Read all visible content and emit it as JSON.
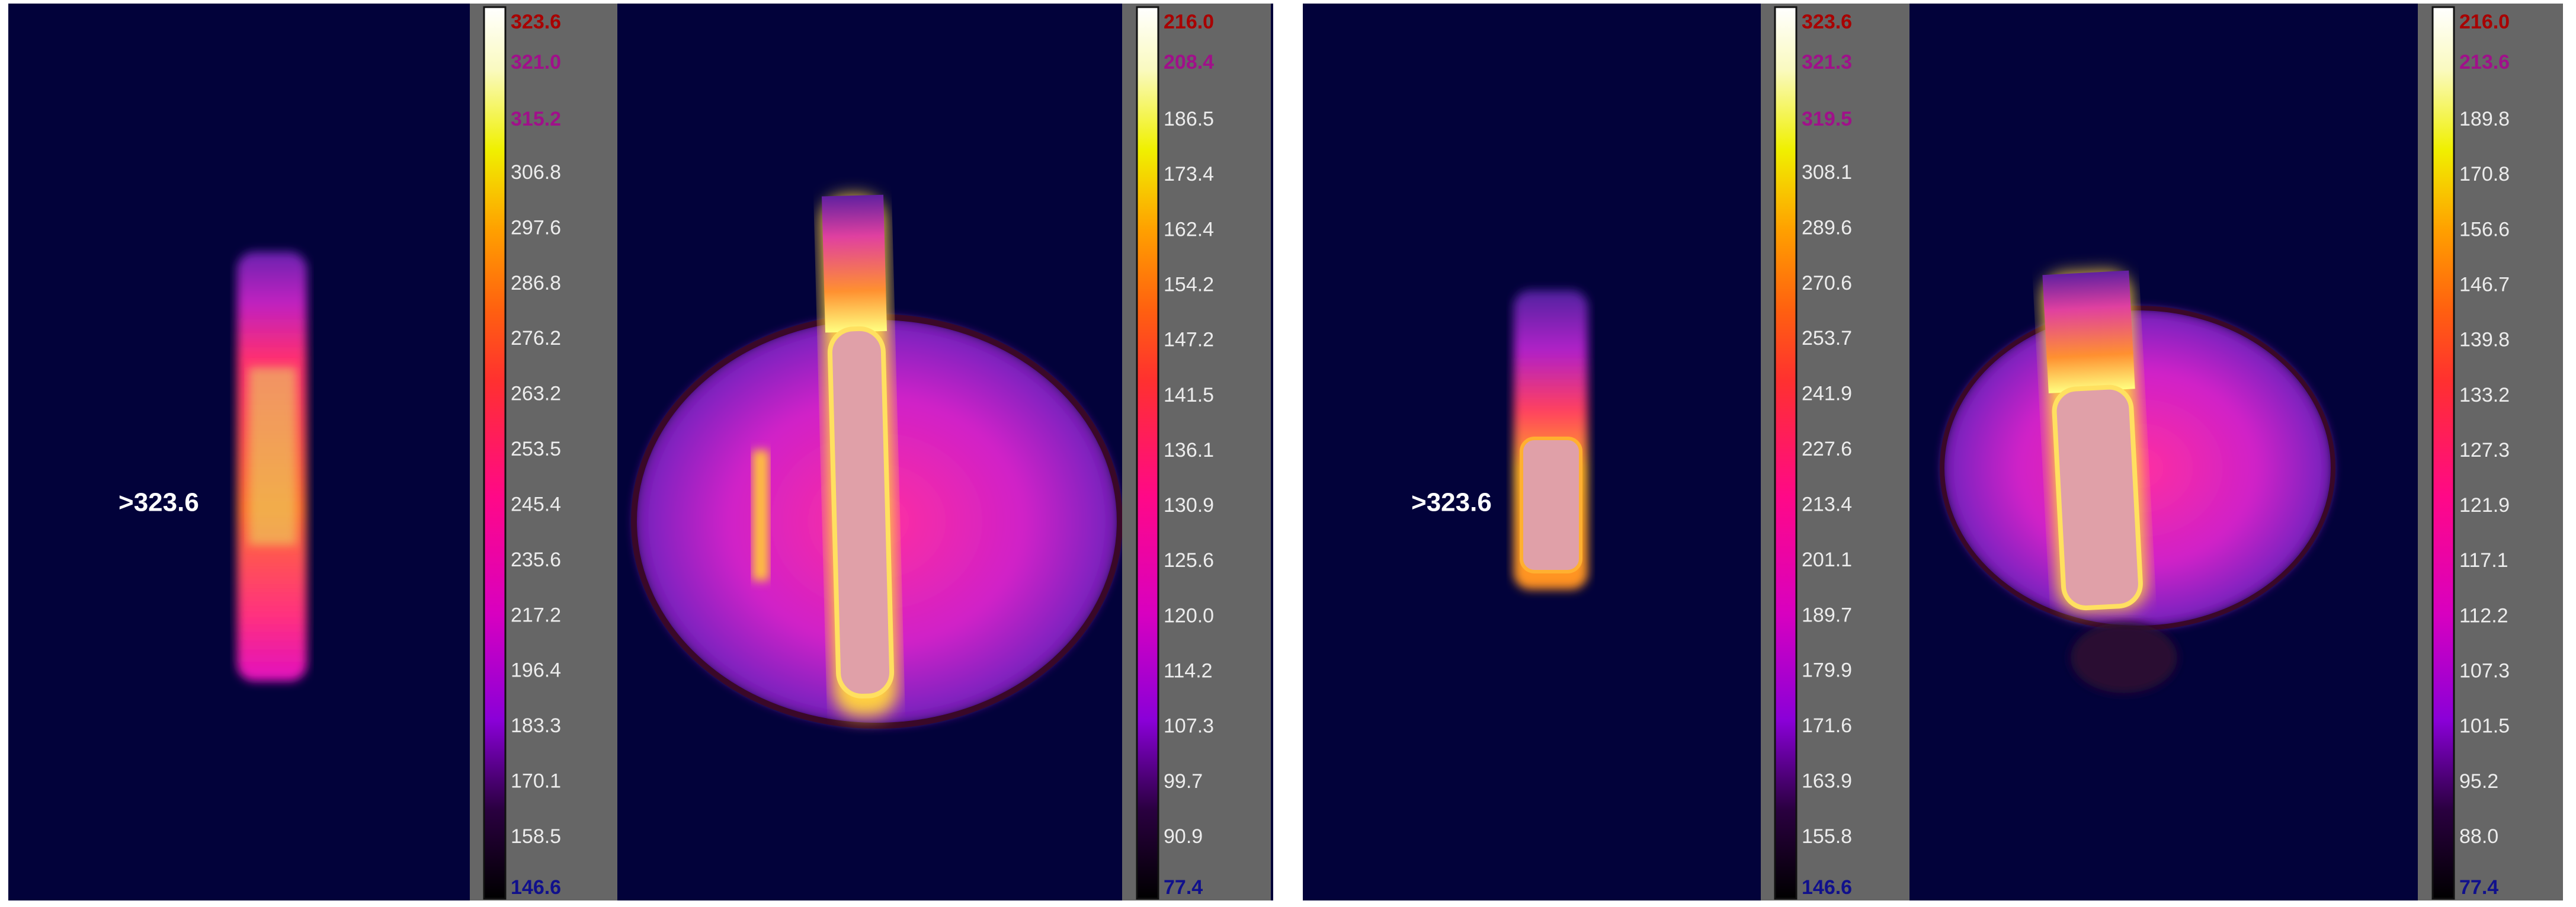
{
  "colors": {
    "background": "#02023a",
    "colorbar_panel": "#666666"
  },
  "panels": [
    {
      "annotation": ">323.6",
      "colorbars": [
        {
          "labels": [
            "323.6",
            "321.0",
            "315.2",
            "306.8",
            "297.6",
            "286.8",
            "276.2",
            "263.2",
            "253.5",
            "245.4",
            "235.6",
            "217.2",
            "196.4",
            "183.3",
            "170.1",
            "158.5",
            "146.6"
          ]
        },
        {
          "labels": [
            "216.0",
            "208.4",
            "186.5",
            "173.4",
            "162.4",
            "154.2",
            "147.2",
            "141.5",
            "136.1",
            "130.9",
            "125.6",
            "120.0",
            "114.2",
            "107.3",
            "99.7",
            "90.9",
            "77.4"
          ]
        }
      ]
    },
    {
      "annotation": ">323.6",
      "colorbars": [
        {
          "labels": [
            "323.6",
            "321.3",
            "319.5",
            "308.1",
            "289.6",
            "270.6",
            "253.7",
            "241.9",
            "227.6",
            "213.4",
            "201.1",
            "189.7",
            "179.9",
            "171.6",
            "163.9",
            "155.8",
            "146.6"
          ]
        },
        {
          "labels": [
            "216.0",
            "213.6",
            "189.8",
            "170.8",
            "156.6",
            "146.7",
            "139.8",
            "133.2",
            "127.3",
            "121.9",
            "117.1",
            "112.2",
            "107.3",
            "101.5",
            "95.2",
            "88.0",
            "77.4"
          ]
        }
      ]
    }
  ]
}
